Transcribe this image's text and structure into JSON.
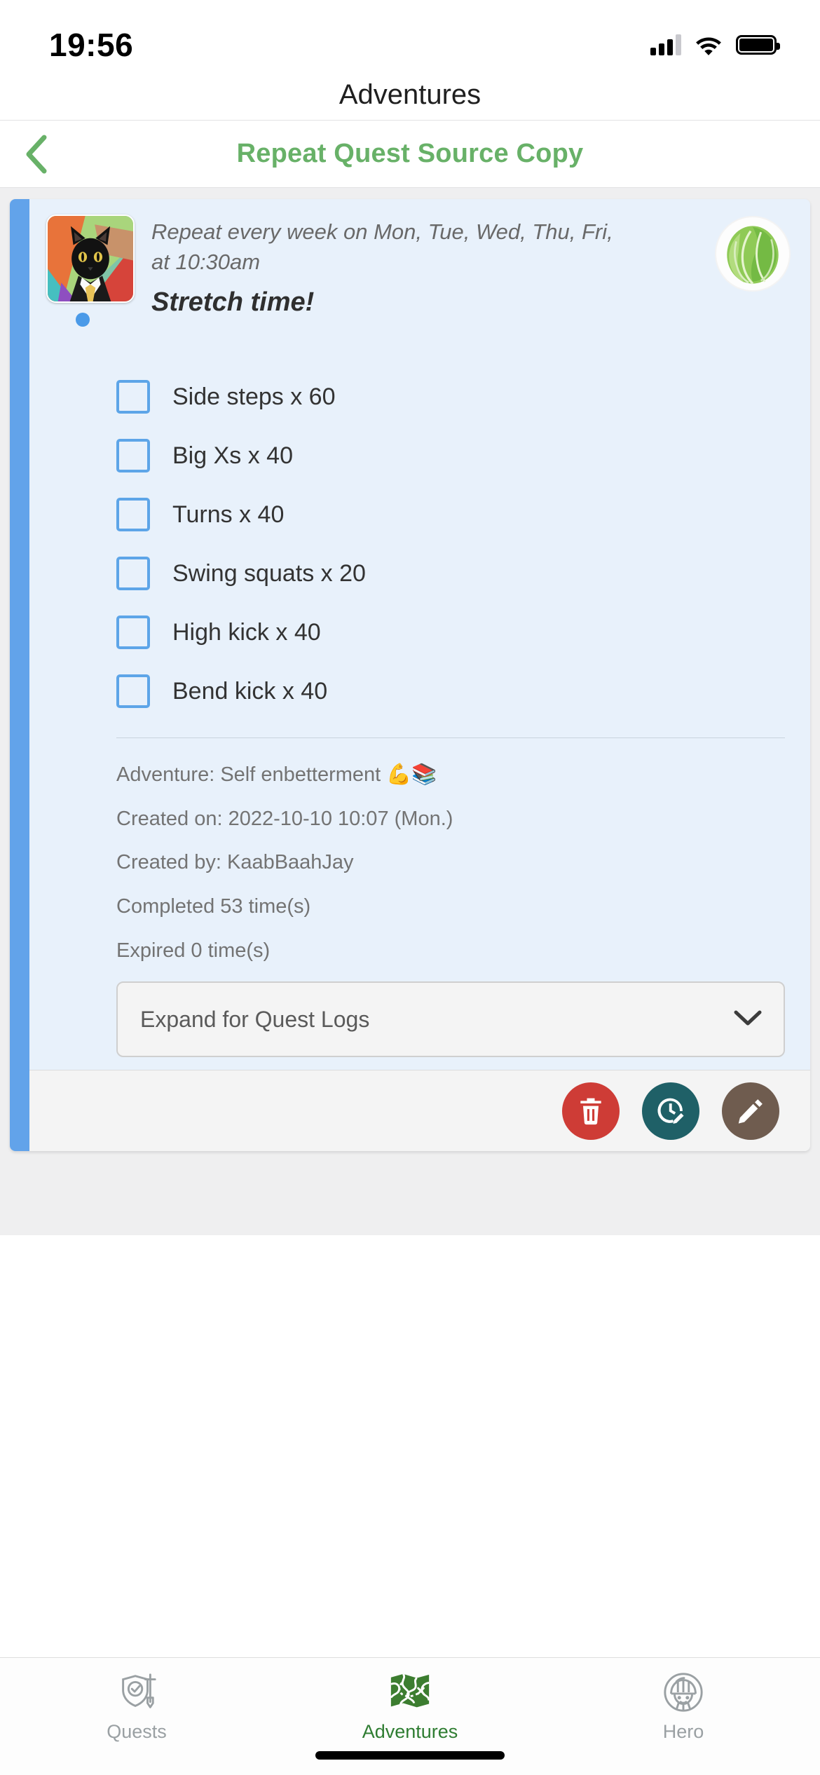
{
  "status_bar": {
    "time": "19:56",
    "signal_icon": "cellular-signal-icon",
    "wifi_icon": "wifi-icon",
    "battery_icon": "battery-full-icon"
  },
  "header": {
    "title": "Adventures"
  },
  "subnav": {
    "back_icon": "chevron-left-icon",
    "title": "Repeat Quest Source Copy",
    "accent_color": "#68b168"
  },
  "quest_card": {
    "accent_bar_color": "#62a3ea",
    "background_color": "#e8f1fb",
    "avatar_icon": "business-cat-avatar",
    "status_dot_color": "#4a9ae8",
    "repeat_text": "Repeat every week on Mon, Tue, Wed, Thu, Fri, at 10:30am",
    "quest_title": "Stretch time!",
    "adventure_badge_icon": "cabbage-icon",
    "checklist": [
      {
        "label": "Side steps x 60",
        "checked": false
      },
      {
        "label": "Big Xs x 40",
        "checked": false
      },
      {
        "label": "Turns x 40",
        "checked": false
      },
      {
        "label": "Swing squats x 20",
        "checked": false
      },
      {
        "label": "High kick x 40",
        "checked": false
      },
      {
        "label": "Bend kick x 40",
        "checked": false
      }
    ],
    "meta": {
      "adventure": "Adventure: Self enbetterment 💪📚",
      "created_on": "Created on: 2022-10-10 10:07 (Mon.)",
      "created_by": "Created by: KaabBaahJay",
      "completed": "Completed 53 time(s)",
      "expired": "Expired 0 time(s)"
    },
    "expander": {
      "label": "Expand for Quest Logs",
      "chevron_icon": "chevron-down-icon"
    },
    "actions": [
      {
        "name": "delete",
        "icon": "trash-icon",
        "color": "#ce3c36"
      },
      {
        "name": "reschedule",
        "icon": "clock-edit-icon",
        "color": "#1f6067"
      },
      {
        "name": "edit",
        "icon": "pencil-icon",
        "color": "#6f5c4f"
      }
    ]
  },
  "tab_bar": {
    "tabs": [
      {
        "label": "Quests",
        "icon": "shield-sword-icon",
        "active": false
      },
      {
        "label": "Adventures",
        "icon": "treasure-map-icon",
        "active": true
      },
      {
        "label": "Hero",
        "icon": "knight-helmet-icon",
        "active": false
      }
    ],
    "active_color": "#2f7d32",
    "inactive_color": "#9aa0a3"
  }
}
